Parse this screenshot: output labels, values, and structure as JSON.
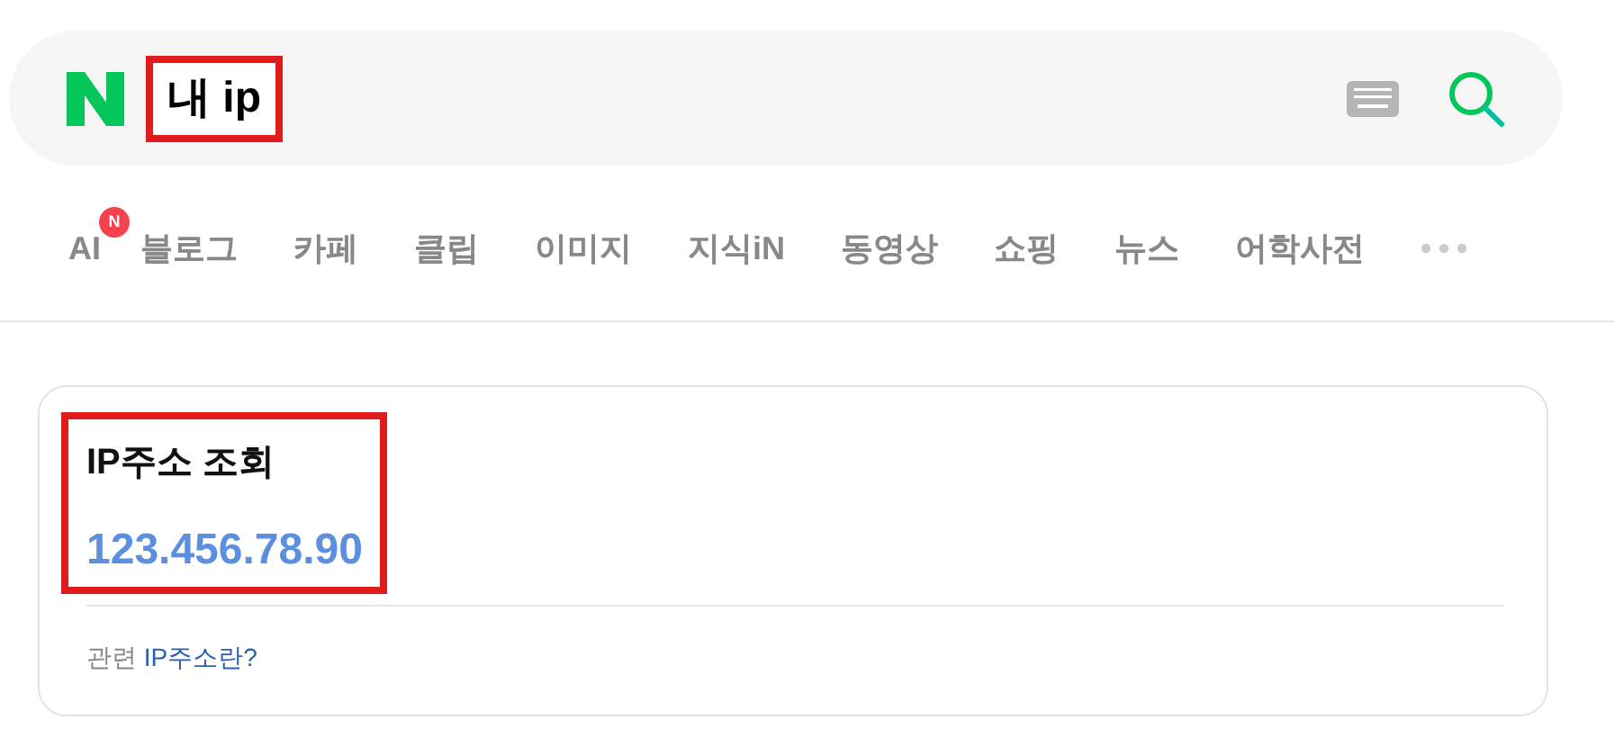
{
  "search": {
    "query": "내 ip",
    "highlighted": true
  },
  "tabs": [
    {
      "label": "AI",
      "badge": "N"
    },
    {
      "label": "블로그"
    },
    {
      "label": "카페"
    },
    {
      "label": "클립"
    },
    {
      "label": "이미지"
    },
    {
      "label": "지식iN"
    },
    {
      "label": "동영상"
    },
    {
      "label": "쇼핑"
    },
    {
      "label": "뉴스"
    },
    {
      "label": "어학사전"
    }
  ],
  "result_card": {
    "title": "IP주소 조회",
    "ip": "123.456.78.90",
    "highlighted": true,
    "related_label": "관련",
    "related_link": "IP주소란?"
  }
}
